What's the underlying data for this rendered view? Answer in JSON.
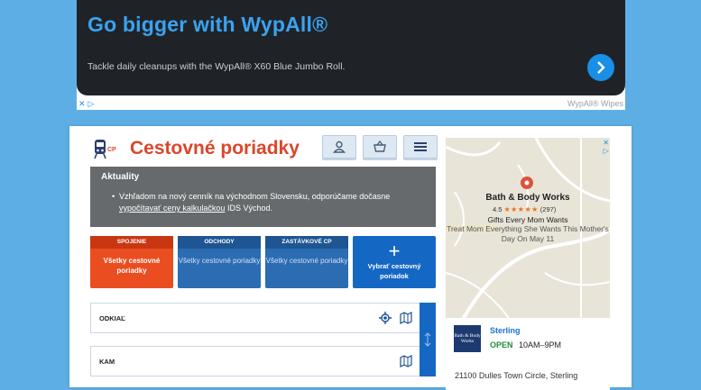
{
  "top_ad": {
    "title": "Go bigger with WypAll®",
    "description": "Tackle daily cleanups with the WypAll® X60 Blue Jumbo Roll.",
    "brand": "WypAll® Wipes",
    "close_glyph": "✕",
    "adchoices_glyph": "▷"
  },
  "header": {
    "logo_badge": "CP",
    "title": "Cestovné poriadky"
  },
  "news": {
    "title": "Aktuality",
    "text_before": "Vzhľadom na nový cenník na východnom Slovensku, odporúčame dočasne",
    "link": "vypočítavať ceny kalkulačkou",
    "text_after": " IDS Východ."
  },
  "tiles": [
    {
      "head": "SPOJENIE",
      "label": "Všetky cestovné poriadky"
    },
    {
      "head": "ODCHODY",
      "label": "Všetky cestovné poriadky"
    },
    {
      "head": "ZASTÁVKOVÉ CP",
      "label": "Všetky cestovné poriadky"
    },
    {
      "head": "+",
      "label": "Vybrať cestovný poriadok"
    }
  ],
  "form": {
    "from_label": "ODKIAĽ",
    "to_label": "KAM"
  },
  "map_ad": {
    "store_title": "Bath & Body Works",
    "rating": "4.5",
    "stars": "★★★★★",
    "review_count": "(297)",
    "line1": "Gifts Every Mom Wants",
    "line2": "Treat Mom Everything She Wants This Mother's Day On May 11",
    "logo_text": "Bath & Body Works",
    "location": "Sterling",
    "status": "OPEN",
    "hours": "10AM–9PM",
    "address": "21100 Dulles Town Circle, Sterling"
  },
  "colors": {
    "accent_red": "#ea4d1f",
    "accent_blue": "#1468c4",
    "page_bg": "#5eaee6"
  }
}
